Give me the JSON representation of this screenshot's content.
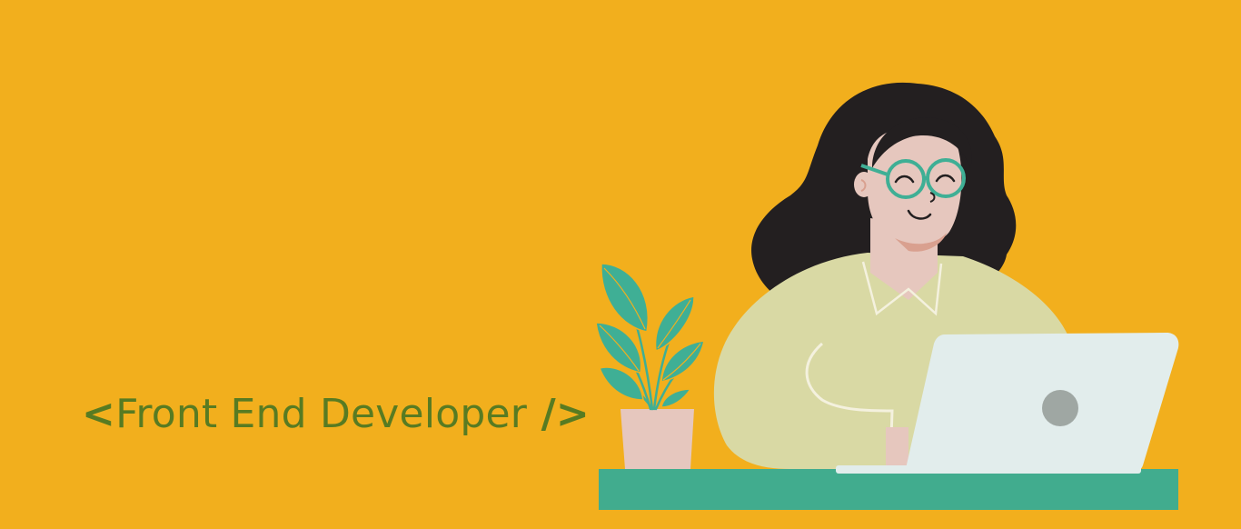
{
  "headline": {
    "open_tag": "<",
    "text": "Front End Developer",
    "close_tag": " />"
  },
  "colors": {
    "background": "#F2AF1D",
    "headline_text": "#587B22",
    "hair": "#231F20",
    "skin": "#E6C7BE",
    "shirt": "#D9D9A4",
    "glasses": "#3FAF95",
    "leaf": "#3FAF95",
    "pot": "#E6C7BE",
    "desk": "#41AC8E",
    "laptop": "#E2EDEC",
    "laptop_logo": "#9FA7A3"
  },
  "icons": [
    "woman-illustration",
    "plant-icon",
    "laptop-icon",
    "desk"
  ]
}
